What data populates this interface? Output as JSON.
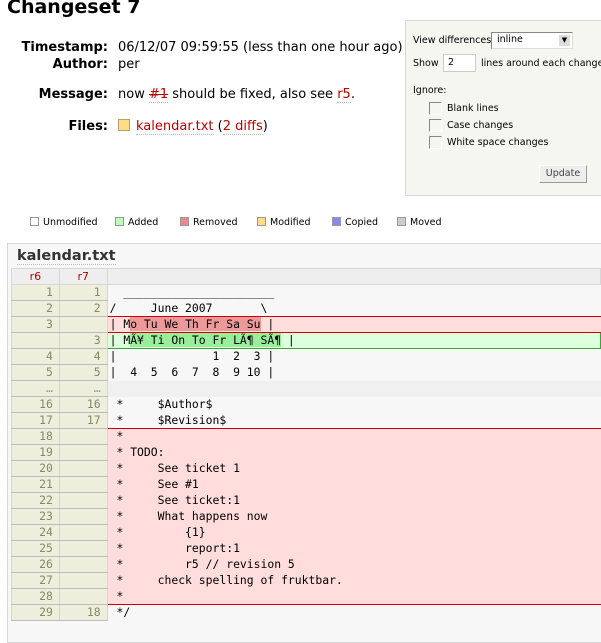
{
  "title": "Changeset 7",
  "props": {
    "timestamp_label": "Timestamp:",
    "timestamp": "06/12/07 09:59:55 (less than one hour ago)",
    "author_label": "Author:",
    "author": "per",
    "message_label": "Message:",
    "message_pre": "now ",
    "message_ticket": "#1",
    "message_mid": " should be fixed, also see ",
    "message_rev": "r5",
    "message_post": ".",
    "files_label": "Files:",
    "file_name": "kalendar.txt",
    "diffs_pre": " (",
    "diffs_link": "2 diffs",
    "diffs_post": ")"
  },
  "options": {
    "view_label": "View differences",
    "view_value": "inline",
    "show_label": "Show",
    "show_value": "2",
    "show_suffix": "lines around each change",
    "ignore_label": "Ignore:",
    "blank": "Blank lines",
    "case": "Case changes",
    "whitespace": "White space changes",
    "update": "Update"
  },
  "legend": [
    {
      "label": "Unmodified",
      "color": "#ffffff"
    },
    {
      "label": "Added",
      "color": "#bbffbb"
    },
    {
      "label": "Removed",
      "color": "#ee8888"
    },
    {
      "label": "Modified",
      "color": "#ffdd88"
    },
    {
      "label": "Copied",
      "color": "#8888ee"
    },
    {
      "label": "Moved",
      "color": "#cccccc"
    }
  ],
  "diff": {
    "file": "kalendar.txt",
    "old_rev": "r6",
    "new_rev": "r7",
    "rows": [
      {
        "old": "1",
        "new": "1",
        "type": "ctx",
        "text": "  ______________________"
      },
      {
        "old": "2",
        "new": "2",
        "type": "ctx",
        "text": "/     June 2007       \\"
      },
      {
        "old": "3",
        "new": "",
        "type": "rem first last",
        "pre": "| M",
        "hl": "o Tu We Th Fr Sa Su",
        "post": " |"
      },
      {
        "old": "",
        "new": "3",
        "type": "add",
        "pre": "| M",
        "hl": "Ã¥ Ti On To Fr LÃ¶ SÃ¶",
        "post": " |"
      },
      {
        "old": "4",
        "new": "4",
        "type": "ctx",
        "text": "|              1  2  3 |"
      },
      {
        "old": "5",
        "new": "5",
        "type": "ctx",
        "text": "|  4  5  6  7  8  9 10 |"
      },
      {
        "old": "…",
        "new": "…",
        "type": "skip",
        "text": ""
      },
      {
        "old": "16",
        "new": "16",
        "type": "ctx",
        "text": " *     $Author$"
      },
      {
        "old": "17",
        "new": "17",
        "type": "ctx",
        "text": " *     $Revision$"
      },
      {
        "old": "18",
        "new": "",
        "type": "rem first",
        "text": " *"
      },
      {
        "old": "19",
        "new": "",
        "type": "rem",
        "text": " * TODO:"
      },
      {
        "old": "20",
        "new": "",
        "type": "rem",
        "text": " *     See ticket 1"
      },
      {
        "old": "21",
        "new": "",
        "type": "rem",
        "text": " *     See #1"
      },
      {
        "old": "22",
        "new": "",
        "type": "rem",
        "text": " *     See ticket:1"
      },
      {
        "old": "23",
        "new": "",
        "type": "rem",
        "text": " *     What happens now"
      },
      {
        "old": "24",
        "new": "",
        "type": "rem",
        "text": " *         {1}"
      },
      {
        "old": "25",
        "new": "",
        "type": "rem",
        "text": " *         report:1"
      },
      {
        "old": "26",
        "new": "",
        "type": "rem",
        "text": " *         r5 // revision 5"
      },
      {
        "old": "27",
        "new": "",
        "type": "rem",
        "text": " *     check spelling of fruktbar."
      },
      {
        "old": "28",
        "new": "",
        "type": "rem last",
        "text": " *"
      },
      {
        "old": "29",
        "new": "18",
        "type": "ctx",
        "text": " */"
      }
    ]
  }
}
